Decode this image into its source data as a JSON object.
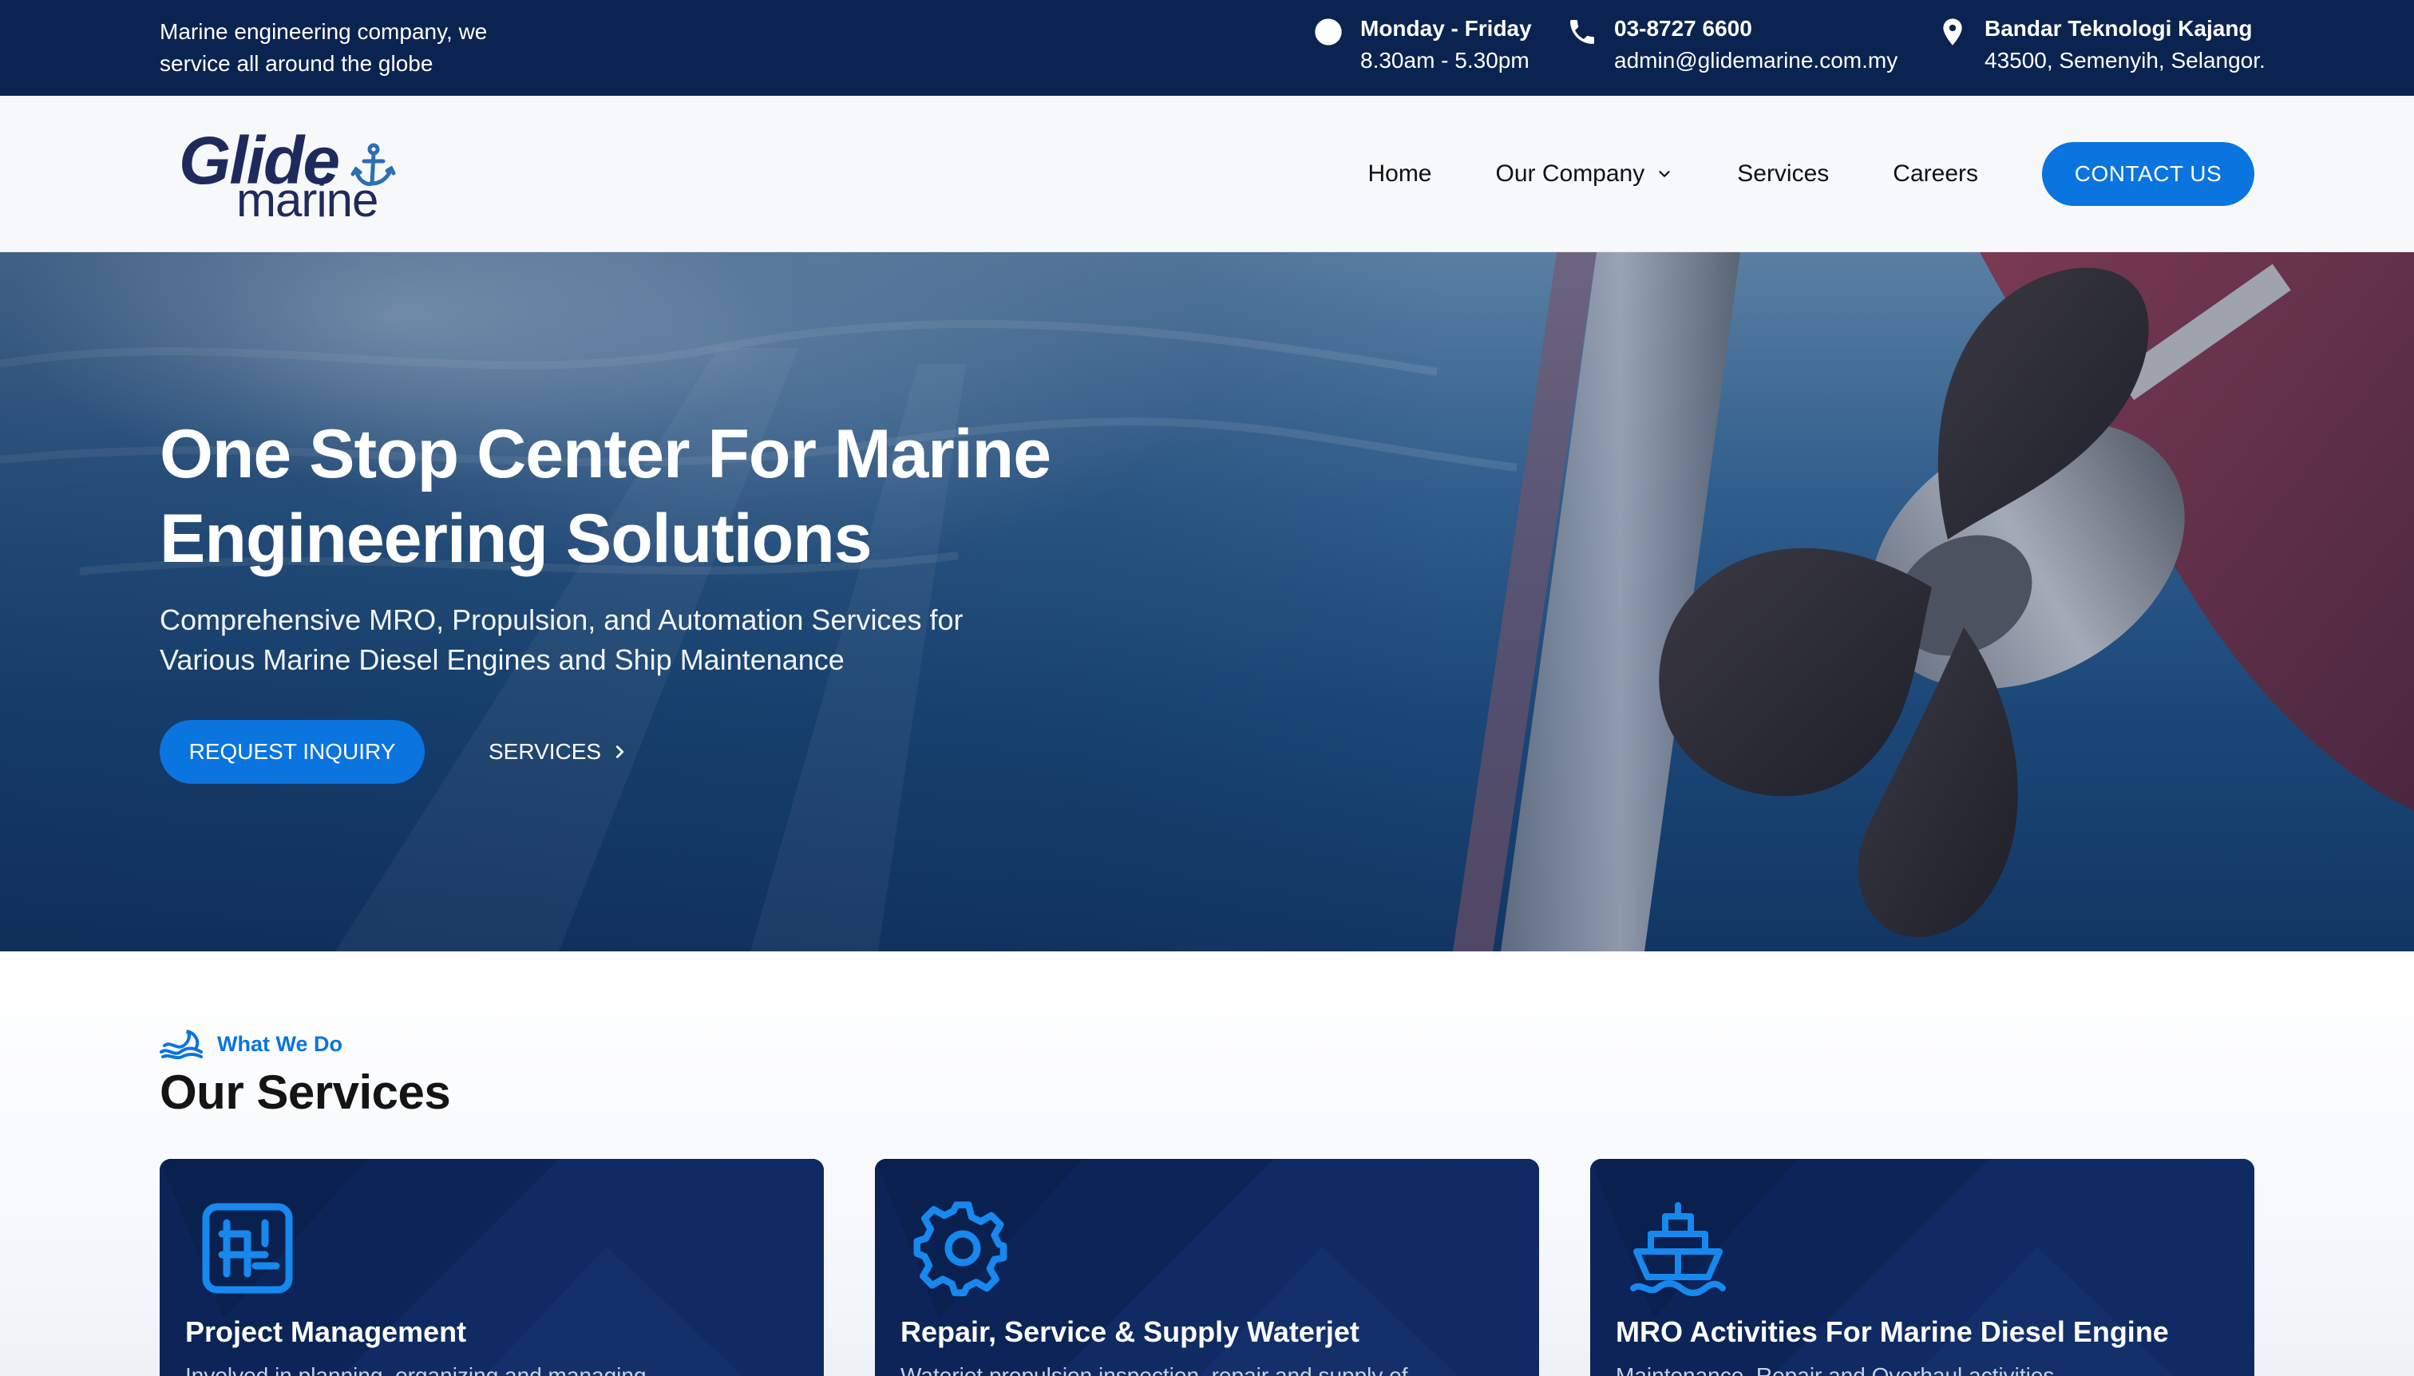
{
  "topbar": {
    "tagline": "Marine engineering company, we service all around the globe",
    "hours_title": "Monday - Friday",
    "hours_value": "8.30am - 5.30pm",
    "phone": "03-8727 6600",
    "email": "admin@glidemarine.com.my",
    "address_title": "Bandar Teknologi Kajang",
    "address_value": "43500, Semenyih, Selangor.",
    "icons": [
      "clock-icon",
      "phone-icon",
      "map-pin-icon"
    ]
  },
  "nav": {
    "logo_main": "Glide",
    "logo_sub": "marine",
    "items": [
      {
        "label": "Home"
      },
      {
        "label": "Our Company"
      },
      {
        "label": "Services"
      },
      {
        "label": "Careers"
      }
    ],
    "contact_label": "CONTACT US"
  },
  "hero": {
    "title": "One Stop Center For Marine Engineering Solutions",
    "subtitle": "Comprehensive MRO, Propulsion, and Automation Services for Various Marine Diesel Engines and Ship Maintenance",
    "primary_cta": "REQUEST INQUIRY",
    "secondary_cta": "SERVICES"
  },
  "services": {
    "kicker": "What We Do",
    "title": "Our Services",
    "cards": [
      {
        "title": "Project Management",
        "icon": "project-management-icon",
        "desc": "Involved in planning, organizing and managing"
      },
      {
        "title": "Repair, Service & Supply Waterjet",
        "icon": "gear-icon",
        "desc": "Waterjet propulsion inspection, repair and supply of"
      },
      {
        "title": "MRO Activities For Marine Diesel Engine",
        "icon": "ship-icon",
        "desc": "Maintenance, Repair and Overhaul activities"
      }
    ]
  },
  "colors": {
    "topbar_bg": "#0a2350",
    "accent": "#0a74df",
    "card_bg": "#0c2457",
    "logo": "#1f2a5c"
  }
}
